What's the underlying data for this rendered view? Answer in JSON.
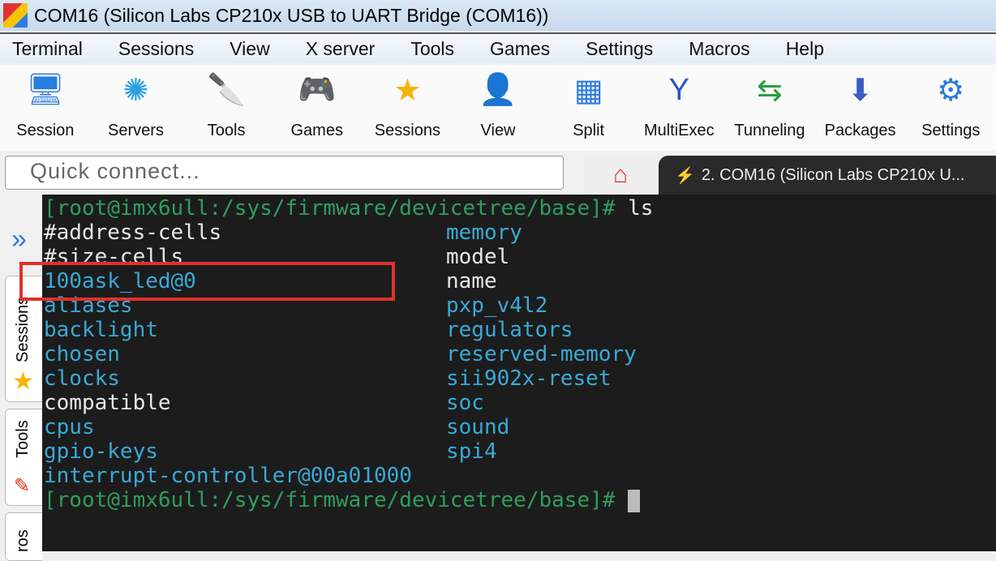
{
  "window": {
    "title": "COM16  (Silicon Labs CP210x USB to UART Bridge (COM16))"
  },
  "menu": [
    "Terminal",
    "Sessions",
    "View",
    "X server",
    "Tools",
    "Games",
    "Settings",
    "Macros",
    "Help"
  ],
  "toolbar": [
    {
      "label": "Session",
      "icon": "monitor-icon"
    },
    {
      "label": "Servers",
      "icon": "network-icon"
    },
    {
      "label": "Tools",
      "icon": "knife-icon"
    },
    {
      "label": "Games",
      "icon": "gamepad-icon"
    },
    {
      "label": "Sessions",
      "icon": "star-icon"
    },
    {
      "label": "View",
      "icon": "user-screen-icon"
    },
    {
      "label": "Split",
      "icon": "split-icon"
    },
    {
      "label": "MultiExec",
      "icon": "fork-icon"
    },
    {
      "label": "Tunneling",
      "icon": "tunnel-icon"
    },
    {
      "label": "Packages",
      "icon": "package-icon"
    },
    {
      "label": "Settings",
      "icon": "gear-icon"
    }
  ],
  "quick_connect": {
    "placeholder": "Quick connect..."
  },
  "tabs": {
    "session": "2. COM16  (Silicon Labs CP210x U..."
  },
  "sidebar": {
    "tabs": [
      "Sessions",
      "Tools",
      "Macros"
    ],
    "visible": [
      "Sessions",
      "Tools",
      "ros"
    ]
  },
  "terminal": {
    "prompt": "[root@imx6ull:/sys/firmware/devicetree/base]# ",
    "command": "ls",
    "col1": [
      {
        "t": "#address-cells",
        "c": "w"
      },
      {
        "t": "#size-cells",
        "c": "w"
      },
      {
        "t": "100ask_led@0",
        "c": "c"
      },
      {
        "t": "aliases",
        "c": "c"
      },
      {
        "t": "backlight",
        "c": "c"
      },
      {
        "t": "chosen",
        "c": "c"
      },
      {
        "t": "clocks",
        "c": "c"
      },
      {
        "t": "compatible",
        "c": "w"
      },
      {
        "t": "cpus",
        "c": "c"
      },
      {
        "t": "gpio-keys",
        "c": "c"
      },
      {
        "t": "interrupt-controller@00a01000",
        "c": "c"
      }
    ],
    "col2": [
      {
        "t": "memory",
        "c": "c"
      },
      {
        "t": "model",
        "c": "w"
      },
      {
        "t": "name",
        "c": "w"
      },
      {
        "t": "pxp_v4l2",
        "c": "c"
      },
      {
        "t": "regulators",
        "c": "c"
      },
      {
        "t": "reserved-memory",
        "c": "c"
      },
      {
        "t": "sii902x-reset",
        "c": "c"
      },
      {
        "t": "soc",
        "c": "c"
      },
      {
        "t": "sound",
        "c": "c"
      },
      {
        "t": "spi4",
        "c": "c"
      }
    ],
    "highlight": "100ask_led@0",
    "colors": {
      "prompt": "#2e9e5e",
      "dir": "#3aa9d6",
      "file": "#e8e8e8",
      "highlight_box": "#e0302a"
    }
  }
}
